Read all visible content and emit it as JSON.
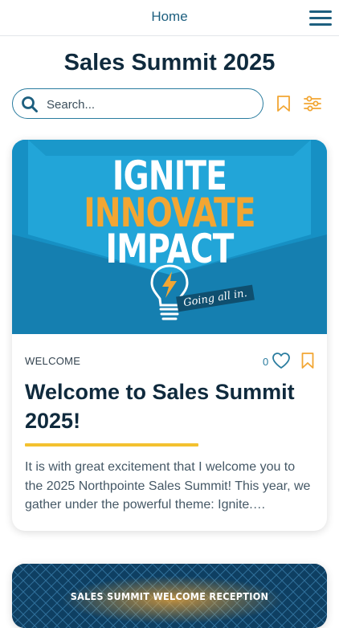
{
  "header": {
    "title": "Home",
    "menu_icon": "hamburger-menu-icon"
  },
  "page": {
    "title": "Sales Summit 2025"
  },
  "search": {
    "placeholder": "Search...",
    "value": ""
  },
  "toolbar": {
    "bookmark_icon": "bookmark-icon",
    "filter_icon": "filter-sliders-icon"
  },
  "colors": {
    "primary": "#1d5f7f",
    "accent_gold": "#f3c12f",
    "bookmark_orange": "#f2a633",
    "hero_blue": "#1a9bcf"
  },
  "posts": [
    {
      "hero": {
        "line1": "IGNITE",
        "line2": "INNOVATE",
        "line3": "IMPACT",
        "tagline": "Going all in."
      },
      "category": "WELCOME",
      "likes": "0",
      "title": "Welcome to Sales Summit 2025!",
      "excerpt": "It is with great excitement that I welcome you to the 2025 Northpointe Sales Summit! This year, we gather under the powerful theme: Ignite.…"
    },
    {
      "hero": {
        "label": "SALES SUMMIT WELCOME RECEPTION"
      }
    }
  ]
}
